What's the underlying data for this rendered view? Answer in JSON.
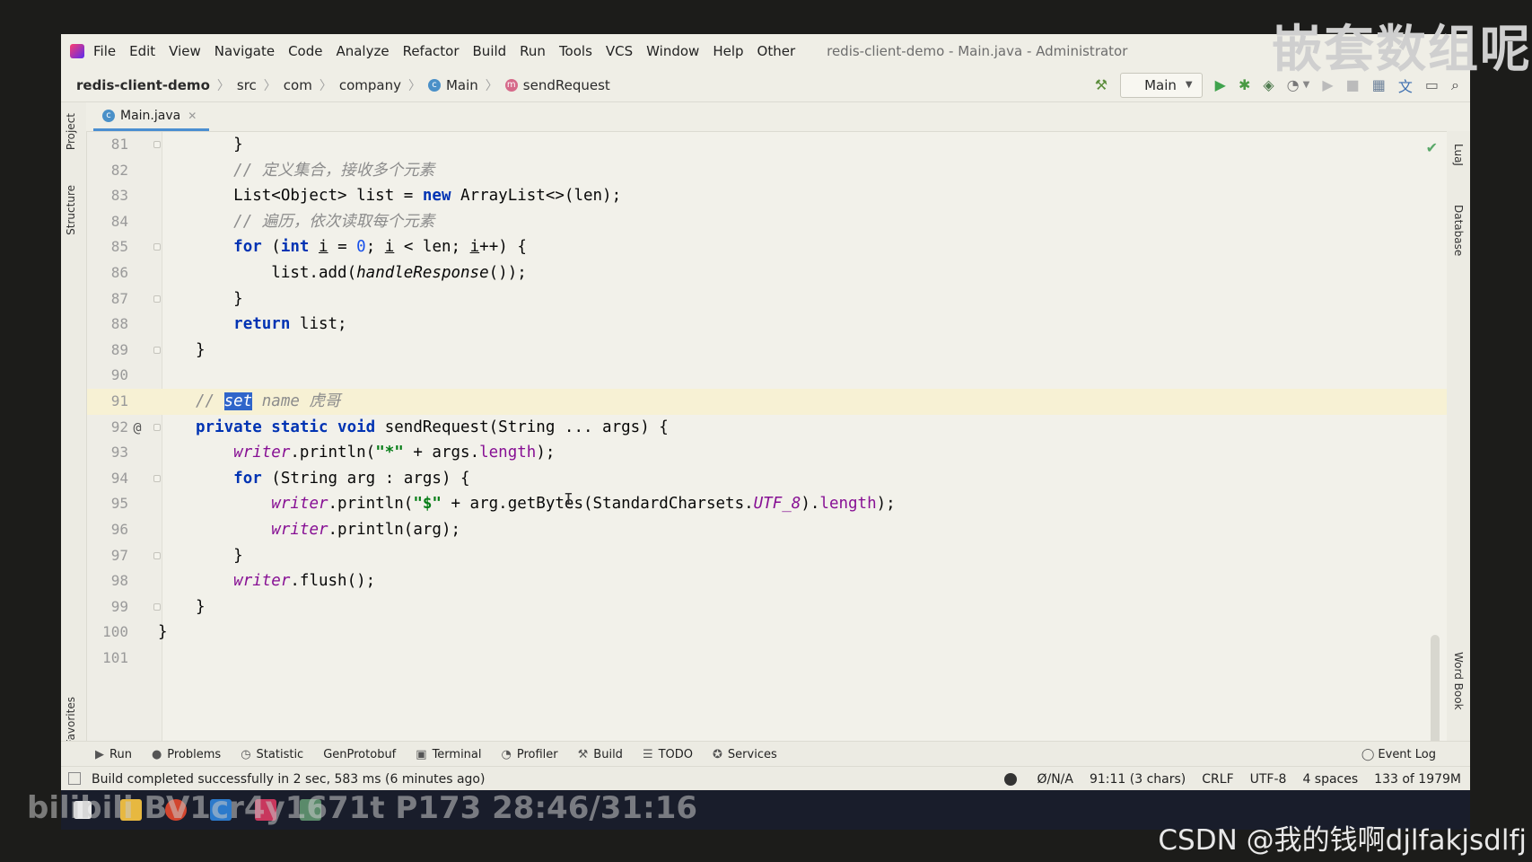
{
  "menu": {
    "items": [
      "File",
      "Edit",
      "View",
      "Navigate",
      "Code",
      "Analyze",
      "Refactor",
      "Build",
      "Run",
      "Tools",
      "VCS",
      "Window",
      "Help",
      "Other"
    ],
    "window_title": "redis-client-demo - Main.java - Administrator"
  },
  "breadcrumb": {
    "project": "redis-client-demo",
    "src": "src",
    "com": "com",
    "company": "company",
    "class": "Main",
    "method": "sendRequest"
  },
  "toolbar": {
    "run_config": "Main"
  },
  "editor_tab": {
    "label": "Main.java"
  },
  "left_tools": [
    "Project",
    "Structure",
    "Favorites"
  ],
  "right_tools": [
    "LuaJ",
    "Database",
    "Word Book"
  ],
  "code": {
    "line_numbers": [
      "81",
      "82",
      "83",
      "84",
      "85",
      "86",
      "87",
      "88",
      "89",
      "90",
      "91",
      "92",
      "93",
      "94",
      "95",
      "96",
      "97",
      "98",
      "99",
      "100",
      "101"
    ],
    "l82_comment": "// 定义集合，接收多个元素",
    "l84_comment": "// 遍历，依次读取每个元素",
    "l91_comment_a": "// ",
    "l91_selected": "set",
    "l91_comment_b": " name 虎哥",
    "l92_gutter_mark": "@"
  },
  "bottom_tools": [
    "Run",
    "Problems",
    "Statistic",
    "GenProtobuf",
    "Terminal",
    "Profiler",
    "Build",
    "TODO",
    "Services"
  ],
  "event_log": "Event Log",
  "status": {
    "message": "Build completed successfully in 2 sec, 583 ms (6 minutes ago)",
    "na": "Ø/N/A",
    "position": "91:11 (3 chars)",
    "line_sep": "CRLF",
    "encoding": "UTF-8",
    "indent": "4 spaces",
    "memory": "133 of 1979M"
  },
  "overlays": {
    "top_watermark": "嵌套数组呢",
    "bili_watermark": "bilibili BV1cr4y1671t P173 28:46/31:16",
    "csdn_watermark": "CSDN @我的钱啊djlfakjsdlfj"
  }
}
